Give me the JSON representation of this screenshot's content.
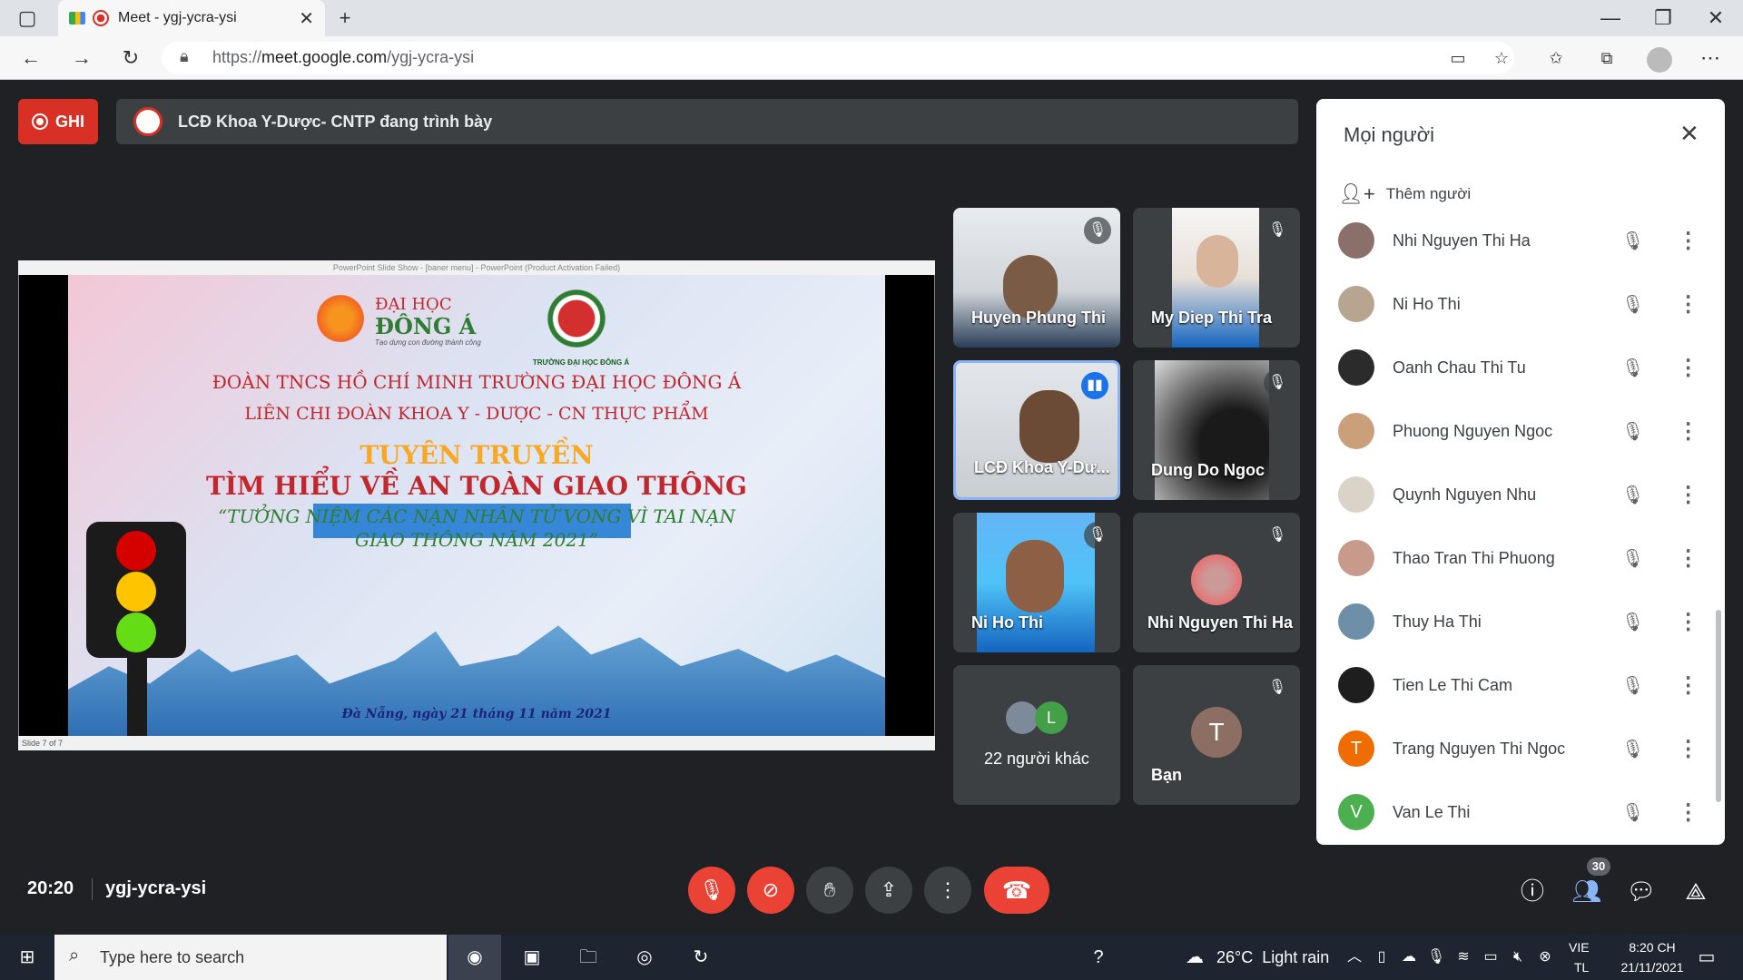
{
  "browser": {
    "tab_title": "Meet - ygj-ycra-ysi",
    "url_prefix": "https://",
    "url_host": "meet.google.com",
    "url_path": "/ygj-ycra-ysi"
  },
  "meet": {
    "record_label": "GHI",
    "presenting_text": "LCĐ Khoa Y-Dược- CNTP đang trình bày",
    "time": "20:20",
    "meeting_code": "ygj-ycra-ysi",
    "participant_count": "30"
  },
  "slide": {
    "window_title": "PowerPoint Slide Show - [baner menu] - PowerPoint (Product Activation Failed)",
    "logo_text_1": "ĐẠI HỌC",
    "logo_text_2": "ĐÔNG Á",
    "logo_slogan": "Tạo dựng con đường thành công",
    "emblem_caption": "TRƯỜNG ĐẠI HỌC ĐÔNG Á",
    "line1": "ĐOÀN TNCS HỒ CHÍ MINH TRƯỜNG ĐẠI HỌC ĐÔNG Á",
    "line2": "LIÊN CHI ĐOÀN KHOA Y - DƯỢC - CN THỰC PHẨM",
    "title1": "TUYÊN TRUYỀN",
    "title2": "TÌM HIỂU VỀ AN TOÀN GIAO THÔNG",
    "quote1": "“TƯỞNG NIỆM CÁC NẠN NHÂN TỬ VONG VÌ TAI NẠN",
    "quote2": "GIAO THÔNG NĂM 2021”",
    "date_line": "Đà Nẵng, ngày 21 tháng 11 năm 2021",
    "footer": "Slide 7 of 7"
  },
  "tiles": [
    {
      "name": "Huyen Phung Thi"
    },
    {
      "name": "My Diep Thi Tra"
    },
    {
      "name": "LCĐ Khoa Y-Dư..."
    },
    {
      "name": "Dung Do Ngoc"
    },
    {
      "name": "Ni Ho Thi"
    },
    {
      "name": "Nhi Nguyen Thi Ha"
    },
    {
      "name": "22 người khác",
      "avatar_letter": "L"
    },
    {
      "name": "Bạn",
      "avatar_letter": "T"
    }
  ],
  "panel": {
    "title": "Mọi người",
    "add_label": "Thêm người",
    "people": [
      {
        "name": "Nhi Nguyen Thi Ha",
        "avatar": "",
        "color": "#8a6f6a"
      },
      {
        "name": "Ni Ho Thi",
        "avatar": "",
        "color": "#b8a58f"
      },
      {
        "name": "Oanh Chau Thi Tu",
        "avatar": "",
        "color": "#2b2b2b"
      },
      {
        "name": "Phuong Nguyen Ngoc",
        "avatar": "",
        "color": "#c9a07a"
      },
      {
        "name": "Quynh Nguyen Nhu",
        "avatar": "",
        "color": "#d9d3c8"
      },
      {
        "name": "Thao Tran Thi Phuong",
        "avatar": "",
        "color": "#c79a8c"
      },
      {
        "name": "Thuy Ha Thi",
        "avatar": "",
        "color": "#6e8fa8"
      },
      {
        "name": "Tien Le Thi Cam",
        "avatar": "",
        "color": "#1e1e1e"
      },
      {
        "name": "Trang Nguyen Thi Ngoc",
        "avatar": "T",
        "color": "#ef6c00"
      },
      {
        "name": "Van Le Thi",
        "avatar": "V",
        "color": "#4caf50"
      }
    ]
  },
  "taskbar": {
    "search_placeholder": "Type here to search",
    "weather": "26°C  Light rain",
    "lang_1": "VIE",
    "lang_2": "TL",
    "time": "8:20 CH",
    "date": "21/11/2021"
  }
}
